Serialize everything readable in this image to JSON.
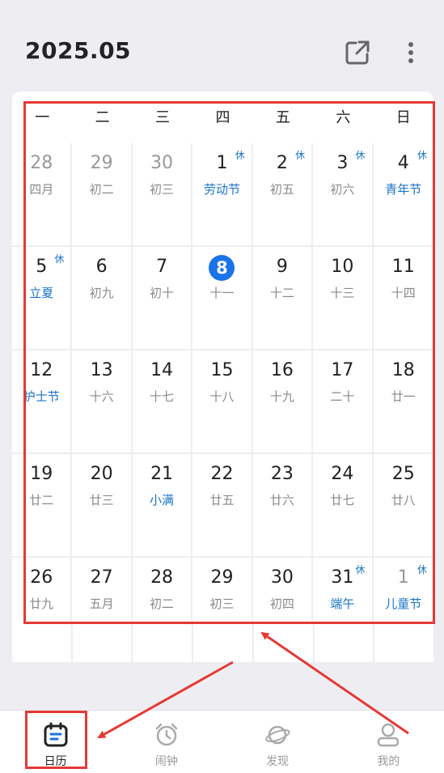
{
  "header": {
    "title": "2025.05",
    "share_icon": "share-icon",
    "more_icon": "more-icon"
  },
  "weekdays": [
    "一",
    "二",
    "三",
    "四",
    "五",
    "六",
    "日"
  ],
  "calendar": [
    [
      {
        "day": "28",
        "sub": "四月",
        "other": true
      },
      {
        "day": "29",
        "sub": "初二",
        "other": true
      },
      {
        "day": "30",
        "sub": "初三",
        "other": true
      },
      {
        "day": "1",
        "sub": "劳动节",
        "fest": true,
        "rest": "休"
      },
      {
        "day": "2",
        "sub": "初五",
        "rest": "休"
      },
      {
        "day": "3",
        "sub": "初六",
        "rest": "休"
      },
      {
        "day": "4",
        "sub": "青年节",
        "fest": true,
        "rest": "休"
      }
    ],
    [
      {
        "day": "5",
        "sub": "立夏",
        "fest": true,
        "rest": "休"
      },
      {
        "day": "6",
        "sub": "初九"
      },
      {
        "day": "7",
        "sub": "初十"
      },
      {
        "day": "8",
        "sub": "十一",
        "today": true
      },
      {
        "day": "9",
        "sub": "十二"
      },
      {
        "day": "10",
        "sub": "十三"
      },
      {
        "day": "11",
        "sub": "十四"
      }
    ],
    [
      {
        "day": "12",
        "sub": "护士节",
        "fest": true
      },
      {
        "day": "13",
        "sub": "十六"
      },
      {
        "day": "14",
        "sub": "十七"
      },
      {
        "day": "15",
        "sub": "十八"
      },
      {
        "day": "16",
        "sub": "十九"
      },
      {
        "day": "17",
        "sub": "二十"
      },
      {
        "day": "18",
        "sub": "廿一"
      }
    ],
    [
      {
        "day": "19",
        "sub": "廿二"
      },
      {
        "day": "20",
        "sub": "廿三"
      },
      {
        "day": "21",
        "sub": "小满",
        "fest": true
      },
      {
        "day": "22",
        "sub": "廿五"
      },
      {
        "day": "23",
        "sub": "廿六"
      },
      {
        "day": "24",
        "sub": "廿七"
      },
      {
        "day": "25",
        "sub": "廿八"
      }
    ],
    [
      {
        "day": "26",
        "sub": "廿九"
      },
      {
        "day": "27",
        "sub": "五月"
      },
      {
        "day": "28",
        "sub": "初二"
      },
      {
        "day": "29",
        "sub": "初三"
      },
      {
        "day": "30",
        "sub": "初四"
      },
      {
        "day": "31",
        "sub": "端午",
        "fest": true,
        "rest": "休"
      },
      {
        "day": "1",
        "sub": "儿童节",
        "fest": true,
        "other": true,
        "rest": "休"
      }
    ]
  ],
  "tabs": [
    {
      "label": "日历",
      "icon": "calendar-icon",
      "active": true
    },
    {
      "label": "闹钟",
      "icon": "alarm-icon"
    },
    {
      "label": "发现",
      "icon": "planet-icon"
    },
    {
      "label": "我的",
      "icon": "profile-icon"
    }
  ],
  "colors": {
    "accent": "#1a73e8",
    "festival": "#1a73c8",
    "highlight": "#e53935"
  }
}
